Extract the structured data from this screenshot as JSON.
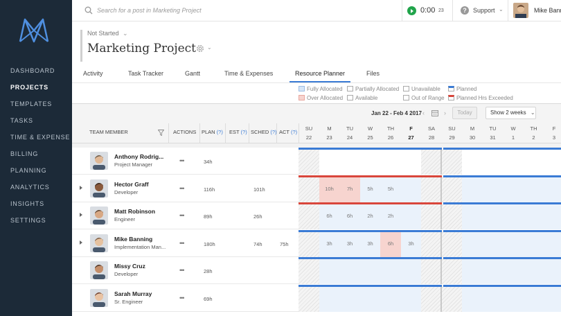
{
  "sidebar": {
    "items": [
      {
        "label": "DASHBOARD",
        "active": false
      },
      {
        "label": "PROJECTS",
        "active": true
      },
      {
        "label": "TEMPLATES",
        "active": false
      },
      {
        "label": "TASKS",
        "active": false
      },
      {
        "label": "TIME & EXPENSE",
        "active": false
      },
      {
        "label": "BILLING",
        "active": false
      },
      {
        "label": "PLANNING",
        "active": false
      },
      {
        "label": "ANALYTICS",
        "active": false
      },
      {
        "label": "INSIGHTS",
        "active": false
      },
      {
        "label": "SETTINGS",
        "active": false
      }
    ]
  },
  "topbar": {
    "search_placeholder": "Search for a post in Marketing Project",
    "timer": {
      "value": "0:00",
      "seconds": "23"
    },
    "support_label": "Support",
    "user_name": "Mike Banning"
  },
  "project": {
    "status": "Not Started",
    "title": "Marketing Project",
    "tabs": [
      {
        "label": "Activity",
        "active": false
      },
      {
        "label": "Task Tracker",
        "active": false
      },
      {
        "label": "Gantt",
        "active": false
      },
      {
        "label": "Time & Expenses",
        "active": false
      },
      {
        "label": "Resource Planner",
        "active": true
      },
      {
        "label": "Files",
        "active": false
      }
    ]
  },
  "legend": [
    {
      "label": "Fully Allocated",
      "color": "#d6e6f7"
    },
    {
      "label": "Over Allocated",
      "color": "#f7d4cf"
    },
    {
      "label": "Partially Allocated",
      "color": "#ffffff"
    },
    {
      "label": "Available",
      "color": "#ffffff"
    },
    {
      "label": "Unavailable",
      "color": "#ffffff"
    },
    {
      "label": "Out of Range",
      "color": "#ffffff"
    },
    {
      "label": "Planned",
      "color": "#3a7bd5"
    },
    {
      "label": "Planned Hrs Exceeded",
      "color": "#d9463b"
    }
  ],
  "toolbar": {
    "date_range": "Jan 22 - Feb 4 2017",
    "today_label": "Today",
    "range_select": "Show 2 weeks"
  },
  "columns": {
    "team_member": "TEAM MEMBER",
    "actions": "ACTIONS",
    "plan": "PLAN",
    "est": "EST",
    "sched": "SCHED",
    "act": "ACT",
    "help": "(?)"
  },
  "days": [
    {
      "dow": "SU",
      "date": "22"
    },
    {
      "dow": "M",
      "date": "23"
    },
    {
      "dow": "TU",
      "date": "24"
    },
    {
      "dow": "W",
      "date": "25"
    },
    {
      "dow": "TH",
      "date": "26"
    },
    {
      "dow": "F",
      "date": "27"
    },
    {
      "dow": "SA",
      "date": "28"
    },
    {
      "dow": "SU",
      "date": "29"
    },
    {
      "dow": "M",
      "date": "30"
    },
    {
      "dow": "TU",
      "date": "31"
    },
    {
      "dow": "W",
      "date": "1"
    },
    {
      "dow": "TH",
      "date": "2"
    },
    {
      "dow": "F",
      "date": "3"
    }
  ],
  "members": [
    {
      "name": "Anthony Rodrig...",
      "role": "Project Manager",
      "plan": "34h",
      "est": "",
      "sched": "",
      "act": "",
      "expandable": false,
      "hours": [
        "",
        "",
        "",
        "",
        "",
        "",
        "",
        "",
        "",
        "",
        "",
        "",
        ""
      ],
      "over": [],
      "bar": [
        "planned",
        "planned"
      ]
    },
    {
      "name": "Hector Graff",
      "role": "Developer",
      "plan": "116h",
      "est": "",
      "sched": "101h",
      "act": "",
      "expandable": true,
      "hours": [
        "",
        "10h",
        "7h",
        "5h",
        "5h",
        "",
        "",
        "",
        "",
        "",
        "",
        "",
        ""
      ],
      "over": [
        1,
        2
      ],
      "bar": [
        "exceeded",
        "planned"
      ]
    },
    {
      "name": "Matt Robinson",
      "role": "Engineer",
      "plan": "89h",
      "est": "",
      "sched": "26h",
      "act": "",
      "expandable": true,
      "hours": [
        "",
        "6h",
        "6h",
        "2h",
        "2h",
        "",
        "",
        "",
        "",
        "",
        "",
        "",
        ""
      ],
      "over": [],
      "bar": [
        "exceeded",
        "planned"
      ]
    },
    {
      "name": "Mike Banning",
      "role": "Implementation Man...",
      "plan": "180h",
      "est": "",
      "sched": "74h",
      "act": "75h",
      "expandable": true,
      "hours": [
        "",
        "3h",
        "3h",
        "3h",
        "6h",
        "3h",
        "",
        "",
        "",
        "",
        "",
        "",
        ""
      ],
      "over": [
        4
      ],
      "bar": [
        "planned",
        "planned"
      ]
    },
    {
      "name": "Missy Cruz",
      "role": "Developer",
      "plan": "28h",
      "est": "",
      "sched": "",
      "act": "",
      "expandable": false,
      "hours": [
        "",
        "",
        "",
        "",
        "",
        "",
        "",
        "",
        "",
        "",
        "",
        "",
        ""
      ],
      "over": [],
      "bar": [
        "planned",
        "planned"
      ]
    },
    {
      "name": "Sarah Murray",
      "role": "Sr. Engineer",
      "plan": "69h",
      "est": "",
      "sched": "",
      "act": "",
      "expandable": false,
      "hours": [
        "",
        "",
        "",
        "",
        "",
        "",
        "",
        "",
        "",
        "",
        "",
        "",
        ""
      ],
      "over": [],
      "bar": [
        "planned",
        "planned"
      ]
    }
  ],
  "colors": {
    "planned": "#3a7bd5",
    "exceeded": "#d9463b",
    "over_allocated": "#f7d4cf",
    "fully_allocated": "#eaf2fb",
    "sidebar": "#1c2a38"
  }
}
